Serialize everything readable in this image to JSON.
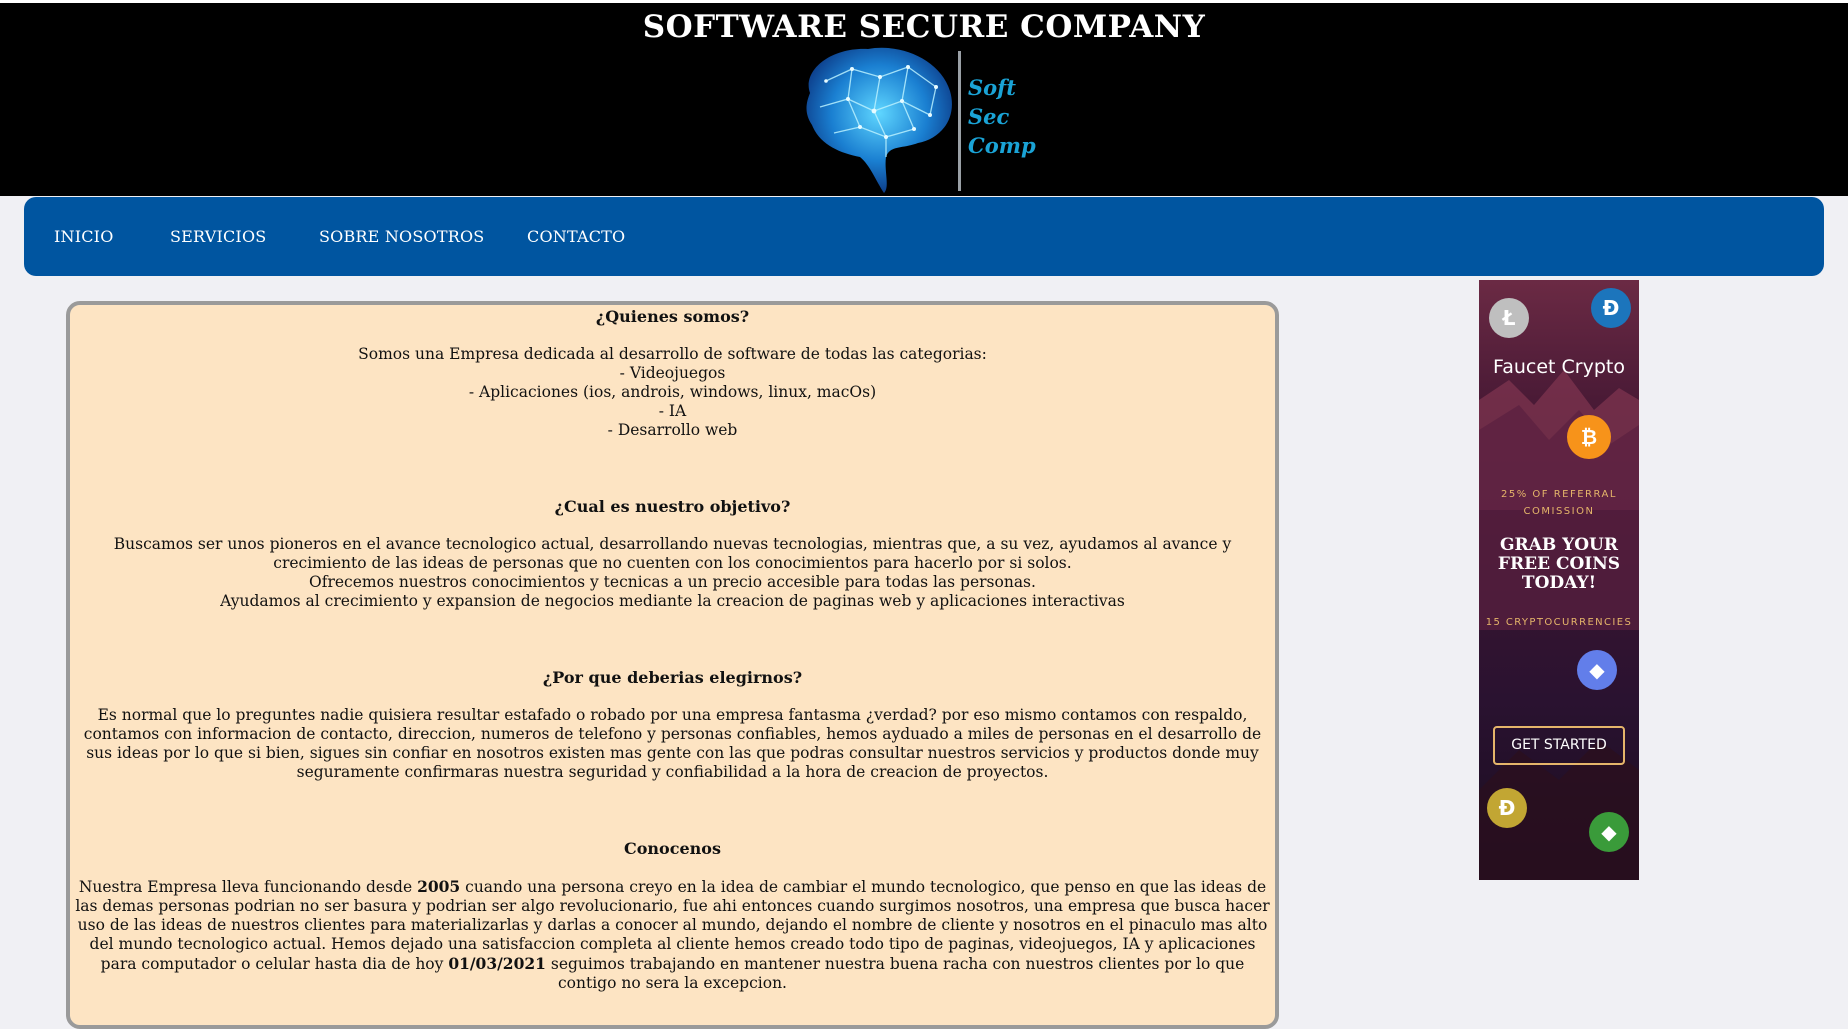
{
  "header": {
    "title": "SOFTWARE SECURE COMPANY",
    "logo_lines": [
      "Soft",
      "Sec",
      "Comp"
    ]
  },
  "nav": {
    "items": [
      {
        "label": "INICIO"
      },
      {
        "label": "SERVICIOS"
      },
      {
        "label": "SOBRE NOSOTROS"
      },
      {
        "label": "CONTACTO"
      }
    ]
  },
  "content": {
    "s1": {
      "heading": "¿Quienes somos?",
      "intro": "Somos una Empresa dedicada al desarrollo de software de todas las categorias:",
      "items": [
        "- Videojuegos",
        "- Aplicaciones (ios, androis, windows, linux, macOs)",
        "- IA",
        "- Desarrollo web"
      ]
    },
    "s2": {
      "heading": "¿Cual es nuestro objetivo?",
      "p1": "Buscamos ser unos pioneros en el avance tecnologico actual, desarrollando nuevas tecnologias, mientras que, a su vez, ayudamos al avance y crecimiento de las ideas de personas que no cuenten con los conocimientos para hacerlo por si solos.",
      "p2": "Ofrecemos nuestros conocimientos y tecnicas a un precio accesible para todas las personas.",
      "p3": "Ayudamos al crecimiento y expansion de negocios mediante la creacion de paginas web y aplicaciones interactivas"
    },
    "s3": {
      "heading": "¿Por que deberias elegirnos?",
      "p1": "Es normal que lo preguntes nadie quisiera resultar estafado o robado por una empresa fantasma ¿verdad? por eso mismo contamos con respaldo, contamos con informacion de contacto, direccion, numeros de telefono y personas confiables, hemos ayduado a miles de personas en el desarrollo de sus ideas por lo que si bien, sigues sin confiar en nosotros existen mas gente con las que podras consultar nuestros servicios y productos donde muy seguramente confirmaras nuestra seguridad y confiabilidad a la hora de creacion de proyectos."
    },
    "s4": {
      "heading": "Conocenos",
      "t1": "Nuestra Empresa lleva funcionando desde ",
      "year": "2005",
      "t2": " cuando una persona creyo en la idea de cambiar el mundo tecnologico, que penso en que las ideas de las demas personas podrian no ser basura y podrian ser algo revolucionario, fue ahi entonces cuando surgimos nosotros, una empresa que busca hacer uso de las ideas de nuestros clientes para materializarlas y darlas a conocer al mundo, dejando el nombre de cliente y nosotros en el pinaculo mas alto del mundo tecnologico actual. Hemos dejado una satisfaccion completa al cliente hemos creado todo tipo de paginas, videojuegos, IA y aplicaciones para computador o celular hasta dia de hoy ",
      "date": "01/03/2021",
      "t3": " seguimos trabajando en mantener nuestra buena racha con nuestros clientes por lo que contigo no sera la excepcion."
    }
  },
  "ad": {
    "title": "Faucet Crypto",
    "referral_line1": "25% OF REFERRAL",
    "referral_line2": "COMISSION",
    "grab_line1": "GRAB YOUR",
    "grab_line2": "FREE COINS",
    "grab_line3": "TODAY!",
    "cryptos": "15 CRYPTOCURRENCIES",
    "button": "GET STARTED",
    "colors": {
      "accent": "#e5b56a",
      "btc": "#f7931a",
      "dash": "#1c75bc",
      "eth": "#627eea"
    }
  },
  "colors": {
    "nav": "#0055a0",
    "content_bg": "#fde4c3",
    "banner": "#000000"
  }
}
